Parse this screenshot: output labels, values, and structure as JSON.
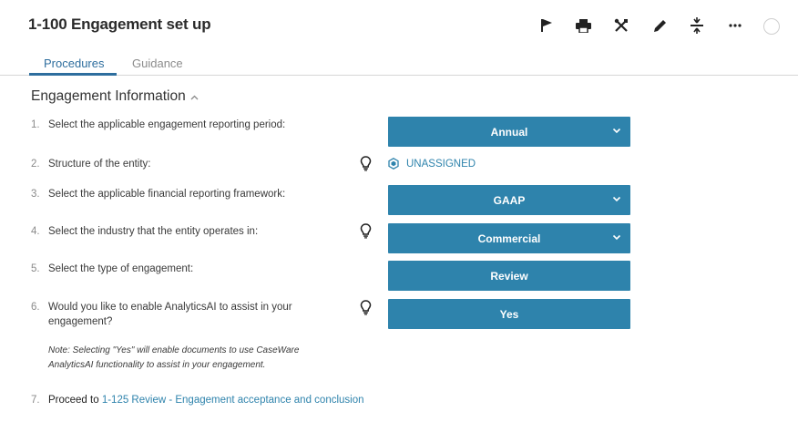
{
  "header": {
    "title": "1-100 Engagement set up"
  },
  "toolbar": {
    "icons": [
      "flag-icon",
      "print-icon",
      "tools-icon",
      "pencil-icon",
      "collapse-icon",
      "more-icon",
      "status-circle-icon"
    ]
  },
  "tabs": [
    {
      "label": "Procedures",
      "active": true
    },
    {
      "label": "Guidance",
      "active": false
    }
  ],
  "section": {
    "title": "Engagement Information"
  },
  "questions": [
    {
      "num": "1.",
      "text": "Select the applicable engagement reporting period:",
      "answer": "Annual",
      "type": "dropdown"
    },
    {
      "num": "2.",
      "text": "Structure of the entity:",
      "answer": "UNASSIGNED",
      "type": "link"
    },
    {
      "num": "3.",
      "text": "Select the applicable financial reporting framework:",
      "answer": "GAAP",
      "type": "dropdown"
    },
    {
      "num": "4.",
      "text": "Select the industry that the entity operates in:",
      "answer": "Commercial",
      "type": "dropdown"
    },
    {
      "num": "5.",
      "text": "Select the type of engagement:",
      "answer": "Review",
      "type": "button"
    },
    {
      "num": "6.",
      "text_line1": "Would you like to enable AnalyticsAI to assist in your",
      "text_line2": "engagement?",
      "answer": "Yes",
      "type": "button"
    }
  ],
  "note": {
    "line1": "Note: Selecting \"Yes\" will enable documents to use CaseWare",
    "line2": "AnalyticsAI functionality to assist in your engagement."
  },
  "proceed": {
    "num": "7.",
    "prefix": "Proceed to",
    "link": "1-125 Review - Engagement acceptance and conclusion"
  },
  "colors": {
    "accent": "#2e83ac",
    "tab_active": "#2e6e9e",
    "text": "#333333"
  }
}
